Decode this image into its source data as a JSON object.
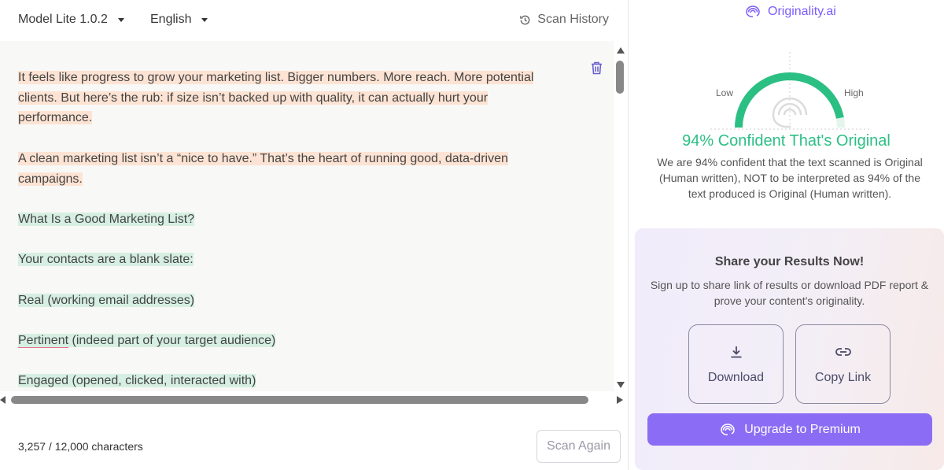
{
  "toolbar": {
    "model_label": "Model Lite 1.0.2",
    "language_label": "English",
    "history_label": "Scan History"
  },
  "editor": {
    "paragraphs": [
      {
        "text": "It feels like progress to grow your marketing list. Bigger numbers. More reach. More potential clients. But here’s the rub: if size isn’t backed up with quality, it can actually hurt your performance.",
        "highlight": "orange"
      },
      {
        "text": "A clean marketing list isn’t a “nice to have.” That’s the heart of running good, data-driven campaigns.",
        "highlight": "orange"
      },
      {
        "text": "What Is a Good Marketing List?",
        "highlight": "green"
      },
      {
        "text": "Your contacts are a blank slate:",
        "highlight": "green"
      },
      {
        "text": "Real (working email addresses)",
        "highlight": "green"
      },
      {
        "text_underlined": "Pertinent",
        "text_rest": " (indeed part of your target audience)",
        "highlight": "green"
      },
      {
        "text": "Engaged (opened, clicked, interacted with)",
        "highlight": "green"
      }
    ]
  },
  "footer": {
    "char_count": "3,257 / 12,000 characters",
    "scan_again_label": "Scan Again"
  },
  "results": {
    "brand": "Originality.ai",
    "gauge_low": "Low",
    "gauge_high": "High",
    "gauge_value_percent": 94,
    "confidence_title": "94% Confident That's Original",
    "explanation": "We are 94% confident that the text scanned is Original (Human written), NOT to be interpreted as 94% of the text produced is Original (Human written)."
  },
  "share": {
    "title": "Share your Results Now!",
    "description": "Sign up to share link of results or download PDF report & prove your content's originality.",
    "download_label": "Download",
    "copy_link_label": "Copy Link",
    "upgrade_label": "Upgrade to Premium"
  },
  "colors": {
    "accent": "#7c5cff",
    "original_green": "#2cbf84",
    "highlight_orange": "#fde3d3",
    "highlight_green": "#d6efe2",
    "upgrade_button": "#8b6cf5"
  },
  "icons": [
    "chevron-down-icon",
    "history-icon",
    "trash-icon",
    "brain-logo-icon",
    "download-icon",
    "link-icon"
  ]
}
